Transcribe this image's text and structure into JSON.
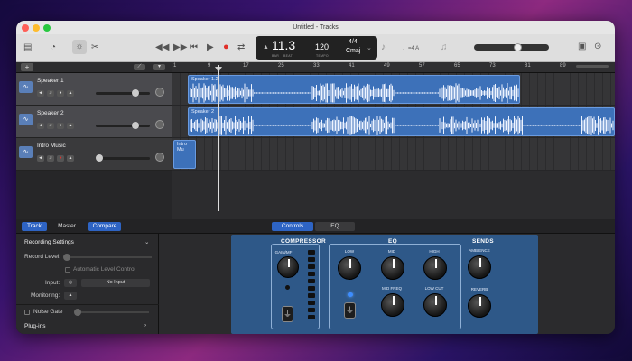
{
  "window": {
    "title": "Untitled - Tracks"
  },
  "lcd": {
    "position": "11.3",
    "pos_label": "BAR",
    "pos_label2": "BEAT",
    "tempo": "120",
    "tempo_label": "TEMPO",
    "sig": "4/4",
    "key": "Cmaj"
  },
  "counter": "♩=4 A",
  "ruler": [
    "1",
    "9",
    "17",
    "25",
    "33",
    "41",
    "49",
    "57",
    "65",
    "73",
    "81",
    "89"
  ],
  "tracks": [
    {
      "name": "Speaker 1"
    },
    {
      "name": "Speaker 2"
    },
    {
      "name": "Intro Music"
    }
  ],
  "regions": [
    "Speaker 1.2",
    "Speaker 2",
    "Intro Mu"
  ],
  "tabs": {
    "track": "Track",
    "master": "Master",
    "compare": "Compare",
    "controls": "Controls",
    "eq": "EQ"
  },
  "inspector": {
    "recording_settings": "Recording Settings",
    "record_level": "Record Level:",
    "auto_level": "Automatic Level Control",
    "input": "Input:",
    "input_value": "No Input",
    "monitoring": "Monitoring:",
    "noise_gate": "Noise Gate",
    "plugins": "Plug-ins"
  },
  "smart": {
    "compressor": "COMPRESSOR",
    "gain": "GAIN/MF",
    "eq": "EQ",
    "low": "LOW",
    "mid": "MID",
    "high": "HIGH",
    "mid_freq": "MID FREQ",
    "low_cut": "LOW CUT",
    "sends": "SENDS",
    "ambience": "AMBIENCE",
    "reverb": "REVERB"
  },
  "colors": {
    "accent": "#2e64c4",
    "region": "#3d71b9",
    "smart_bg": "#2e5888"
  }
}
